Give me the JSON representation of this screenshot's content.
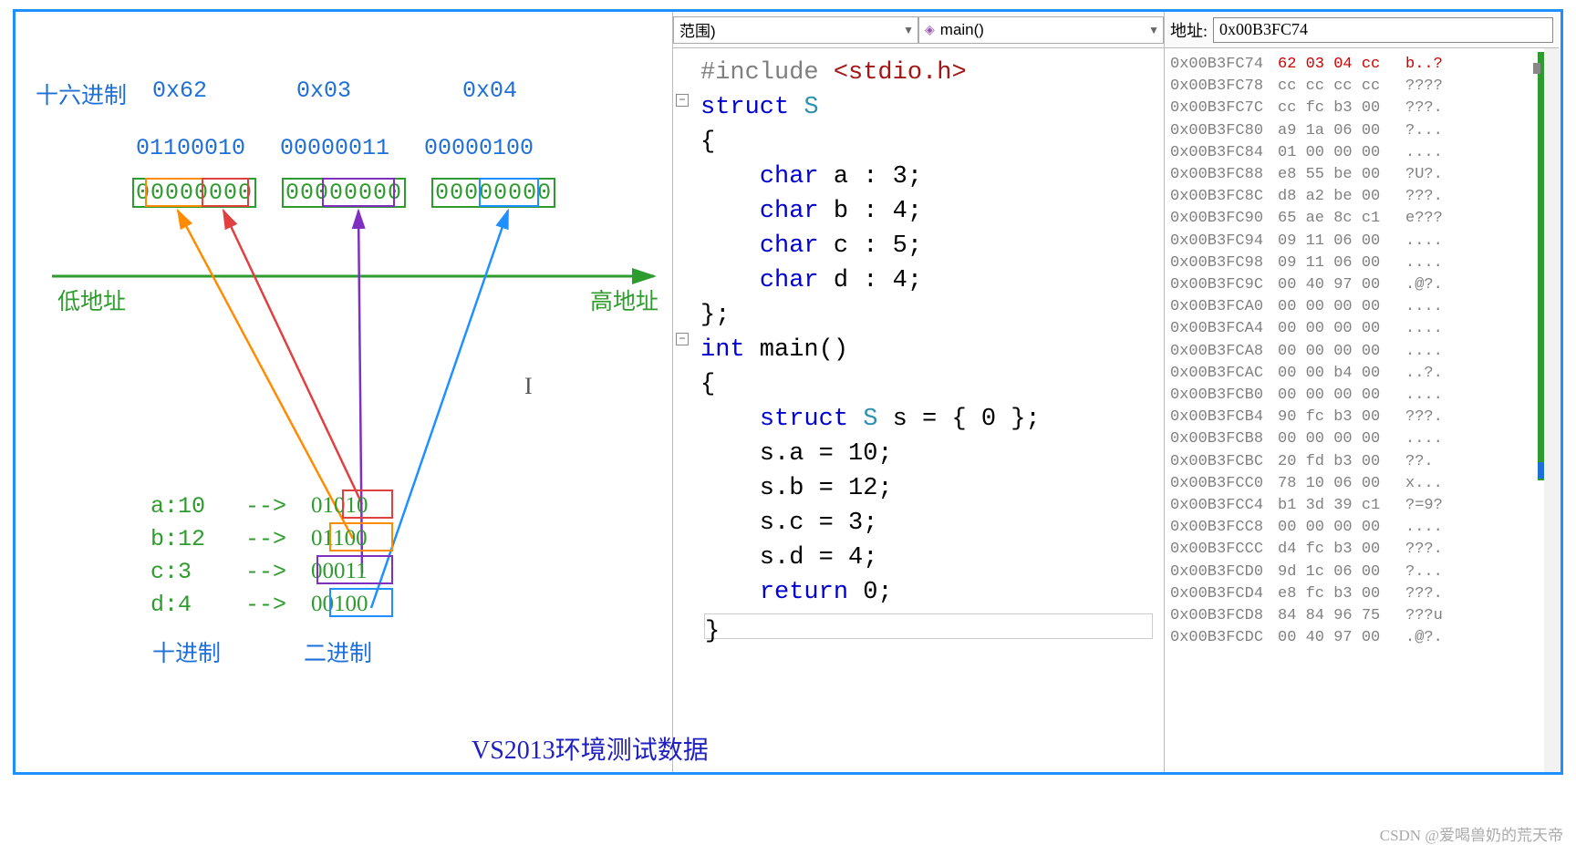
{
  "hex_label": "十六进制",
  "hex_values": [
    "0x62",
    "0x03",
    "0x04"
  ],
  "bin_header": [
    "01100010",
    "00000011",
    "00000100"
  ],
  "byte_boxes": [
    "00000000",
    "00000000",
    "00000000"
  ],
  "low_addr": "低地址",
  "high_addr": "高地址",
  "assignments": [
    {
      "name": "a:10",
      "bits": "01010"
    },
    {
      "name": "b:12",
      "bits": "01100"
    },
    {
      "name": "c:3",
      "bits": "00011"
    },
    {
      "name": "d:4",
      "bits": "00100"
    }
  ],
  "dec_label": "十进制",
  "bin_label": "二进制",
  "caption": "VS2013环境测试数据",
  "watermark": "CSDN @爱喝兽奶的荒天帝",
  "scope_combo": "范围)",
  "func_combo": "main()",
  "code_lines": [
    {
      "raw": "#include <stdio.h>"
    },
    {
      "raw": "struct S"
    },
    {
      "raw": "{"
    },
    {
      "raw": "    char a : 3;"
    },
    {
      "raw": "    char b : 4;"
    },
    {
      "raw": "    char c : 5;"
    },
    {
      "raw": "    char d : 4;"
    },
    {
      "raw": "};"
    },
    {
      "raw": "int main()"
    },
    {
      "raw": "{"
    },
    {
      "raw": "    struct S s = { 0 };"
    },
    {
      "raw": "    s.a = 10;"
    },
    {
      "raw": "    s.b = 12;"
    },
    {
      "raw": "    s.c = 3;"
    },
    {
      "raw": "    s.d = 4;"
    },
    {
      "raw": "    return 0;"
    },
    {
      "raw": "}"
    }
  ],
  "addr_label": "地址:",
  "addr_value": "0x00B3FC74",
  "memory_rows": [
    {
      "a": "0x00B3FC74",
      "h": "62 03 04 cc",
      "t": "b..?",
      "hi": true
    },
    {
      "a": "0x00B3FC78",
      "h": "cc cc cc cc",
      "t": "????"
    },
    {
      "a": "0x00B3FC7C",
      "h": "cc fc b3 00",
      "t": "???."
    },
    {
      "a": "0x00B3FC80",
      "h": "a9 1a 06 00",
      "t": "?..."
    },
    {
      "a": "0x00B3FC84",
      "h": "01 00 00 00",
      "t": "...."
    },
    {
      "a": "0x00B3FC88",
      "h": "e8 55 be 00",
      "t": "?U?."
    },
    {
      "a": "0x00B3FC8C",
      "h": "d8 a2 be 00",
      "t": "???."
    },
    {
      "a": "0x00B3FC90",
      "h": "65 ae 8c c1",
      "t": "e???"
    },
    {
      "a": "0x00B3FC94",
      "h": "09 11 06 00",
      "t": "...."
    },
    {
      "a": "0x00B3FC98",
      "h": "09 11 06 00",
      "t": "...."
    },
    {
      "a": "0x00B3FC9C",
      "h": "00 40 97 00",
      "t": ".@?."
    },
    {
      "a": "0x00B3FCA0",
      "h": "00 00 00 00",
      "t": "...."
    },
    {
      "a": "0x00B3FCA4",
      "h": "00 00 00 00",
      "t": "...."
    },
    {
      "a": "0x00B3FCA8",
      "h": "00 00 00 00",
      "t": "...."
    },
    {
      "a": "0x00B3FCAC",
      "h": "00 00 b4 00",
      "t": "..?."
    },
    {
      "a": "0x00B3FCB0",
      "h": "00 00 00 00",
      "t": "...."
    },
    {
      "a": "0x00B3FCB4",
      "h": "90 fc b3 00",
      "t": "???."
    },
    {
      "a": "0x00B3FCB8",
      "h": "00 00 00 00",
      "t": "...."
    },
    {
      "a": "0x00B3FCBC",
      "h": "20 fd b3 00",
      "t": " ??."
    },
    {
      "a": "0x00B3FCC0",
      "h": "78 10 06 00",
      "t": "x..."
    },
    {
      "a": "0x00B3FCC4",
      "h": "b1 3d 39 c1",
      "t": "?=9?"
    },
    {
      "a": "0x00B3FCC8",
      "h": "00 00 00 00",
      "t": "...."
    },
    {
      "a": "0x00B3FCCC",
      "h": "d4 fc b3 00",
      "t": "???."
    },
    {
      "a": "0x00B3FCD0",
      "h": "9d 1c 06 00",
      "t": "?..."
    },
    {
      "a": "0x00B3FCD4",
      "h": "e8 fc b3 00",
      "t": "???."
    },
    {
      "a": "0x00B3FCD8",
      "h": "84 84 96 75",
      "t": "???u"
    },
    {
      "a": "0x00B3FCDC",
      "h": "00 40 97 00",
      "t": ".@?."
    }
  ],
  "arrow_label": "-->",
  "colors": {
    "a": "#e04040",
    "b": "#ff8c00",
    "c": "#8030c0",
    "d": "#1e90ff",
    "box": "#2e9b2e"
  }
}
